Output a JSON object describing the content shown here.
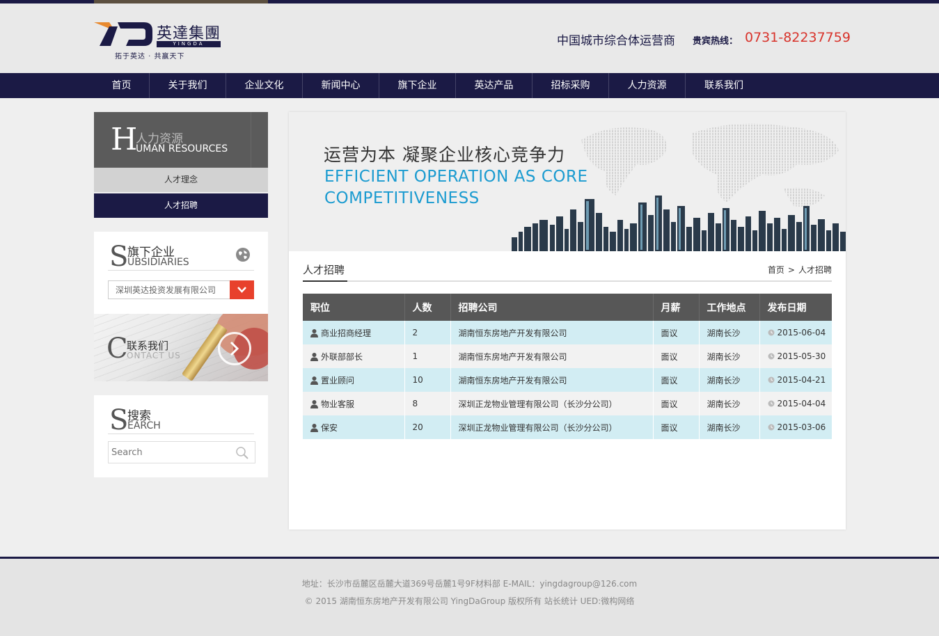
{
  "header": {
    "logo_cn": "英達集團",
    "logo_en": "YINGDA",
    "logo_slogan": "拓于英达 · 共赢天下",
    "tagline": "中国城市综合体运营商",
    "hotline_label": "贵宾热线：",
    "hotline_number": "0731-82237759"
  },
  "nav": {
    "items": [
      {
        "label": "首页"
      },
      {
        "label": "关于我们"
      },
      {
        "label": "企业文化"
      },
      {
        "label": "新闻中心"
      },
      {
        "label": "旗下企业"
      },
      {
        "label": "英达产品"
      },
      {
        "label": "招标采购"
      },
      {
        "label": "人力资源"
      },
      {
        "label": "联系我们"
      }
    ]
  },
  "sidebar": {
    "hr": {
      "letter": "H",
      "cn": "人力资源",
      "en": "UMAN RESOURCES"
    },
    "links": [
      {
        "label": "人才理念"
      },
      {
        "label": "人才招聘"
      }
    ],
    "subsidiaries": {
      "letter": "S",
      "cn": "旗下企业",
      "en": "UBSIDIARIES",
      "selected": "深圳英达投资发展有限公司"
    },
    "contact": {
      "letter": "C",
      "cn": "联系我们",
      "en": "ONTACT US"
    },
    "search": {
      "letter": "S",
      "cn": "搜索",
      "en": "EARCH",
      "placeholder": "Search"
    }
  },
  "banner": {
    "cn": "运营为本  凝聚企业核心竞争力",
    "en": "EFFICIENT OPERATION AS CORE COMPETITIVENESS"
  },
  "section": {
    "title": "人才招聘",
    "breadcrumb": [
      "首页",
      "人才招聘"
    ],
    "breadcrumb_sep": ">"
  },
  "jobs": {
    "headers": [
      "职位",
      "人数",
      "招聘公司",
      "月薪",
      "工作地点",
      "发布日期"
    ],
    "rows": [
      {
        "position": "商业招商经理",
        "count": "2",
        "company": "湖南恒东房地产开发有限公司",
        "salary": "面议",
        "location": "湖南长沙",
        "date": "2015-06-04"
      },
      {
        "position": "外联部部长",
        "count": "1",
        "company": "湖南恒东房地产开发有限公司",
        "salary": "面议",
        "location": "湖南长沙",
        "date": "2015-05-30"
      },
      {
        "position": "置业顾问",
        "count": "10",
        "company": "湖南恒东房地产开发有限公司",
        "salary": "面议",
        "location": "湖南长沙",
        "date": "2015-04-21"
      },
      {
        "position": "物业客服",
        "count": "8",
        "company": "深圳正龙物业管理有限公司（长沙分公司）",
        "salary": "面议",
        "location": "湖南长沙",
        "date": "2015-04-04"
      },
      {
        "position": "保安",
        "count": "20",
        "company": "深圳正龙物业管理有限公司（长沙分公司）",
        "salary": "面议",
        "location": "湖南长沙",
        "date": "2015-03-06"
      }
    ]
  },
  "footer": {
    "line1": "地址：长沙市岳麓区岳麓大道369号岳麓1号9F材料部    E-MAIL：yingdagroup@126.com",
    "line2": "© 2015 湖南恒东房地产开发有限公司 YingDaGroup 版权所有 站长统计 UED:微构网络"
  },
  "colors": {
    "brand_navy": "#1b1a45",
    "hotline_red": "#d8332b",
    "banner_blue": "#1b9bd0",
    "select_red": "#e8412c",
    "row_highlight": "#d2edf3"
  },
  "icons": [
    "globe-icon",
    "chevron-down-icon",
    "arrow-right-icon",
    "search-icon",
    "person-icon",
    "clock-icon"
  ]
}
